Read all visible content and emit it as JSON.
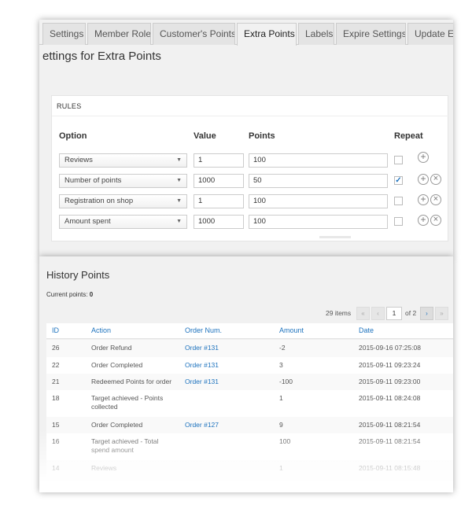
{
  "tabs": [
    "Settings",
    "Member Role",
    "Customer's Points",
    "Extra Points",
    "Labels",
    "Expire Settings",
    "Update E"
  ],
  "page_heading": "ettings for Extra Points",
  "rules": {
    "title": "RULES",
    "columns": {
      "option": "Option",
      "value": "Value",
      "points": "Points",
      "repeat": "Repeat"
    },
    "rows": [
      {
        "option": "Reviews",
        "value": "1",
        "points": "100",
        "repeat": false
      },
      {
        "option": "Number of points",
        "value": "1000",
        "points": "50",
        "repeat": true
      },
      {
        "option": "Registration on shop",
        "value": "1",
        "points": "100",
        "repeat": false
      },
      {
        "option": "Amount spent",
        "value": "1000",
        "points": "100",
        "repeat": false
      }
    ]
  },
  "history": {
    "title": "History Points",
    "current_points_label": "Current points:",
    "current_points_value": "0",
    "items_count": "29 items",
    "pagination": {
      "first": "«",
      "prev": "‹",
      "current_page": "1",
      "of_pages": "of 2",
      "next": "›",
      "last": "»"
    },
    "columns": {
      "id": "ID",
      "action": "Action",
      "order": "Order Num.",
      "amount": "Amount",
      "date": "Date"
    },
    "rows": [
      {
        "id": "26",
        "action": "Order Refund",
        "order": "Order #131",
        "amount": "-2",
        "date": "2015-09-16 07:25:08"
      },
      {
        "id": "22",
        "action": "Order Completed",
        "order": "Order #131",
        "amount": "3",
        "date": "2015-09-11 09:23:24"
      },
      {
        "id": "21",
        "action": "Redeemed Points for order",
        "order": "Order #131",
        "amount": "-100",
        "date": "2015-09-11 09:23:00"
      },
      {
        "id": "18",
        "action": "Target achieved - Points collected",
        "order": "",
        "amount": "1",
        "date": "2015-09-11 08:24:08"
      },
      {
        "id": "15",
        "action": "Order Completed",
        "order": "Order #127",
        "amount": "9",
        "date": "2015-09-11 08:21:54"
      },
      {
        "id": "16",
        "action": "Target achieved - Total spend amount",
        "order": "",
        "amount": "100",
        "date": "2015-09-11 08:21:54"
      },
      {
        "id": "14",
        "action": "Reviews",
        "order": "",
        "amount": "1",
        "date": "2015-09-11 08:15:48"
      }
    ]
  },
  "colors": {
    "accent": "#1e73be",
    "panel": "#f1f1f1"
  },
  "icons": {
    "add": "plus-circle-icon",
    "remove": "x-circle-icon",
    "dropdown": "triangle-down-icon"
  }
}
